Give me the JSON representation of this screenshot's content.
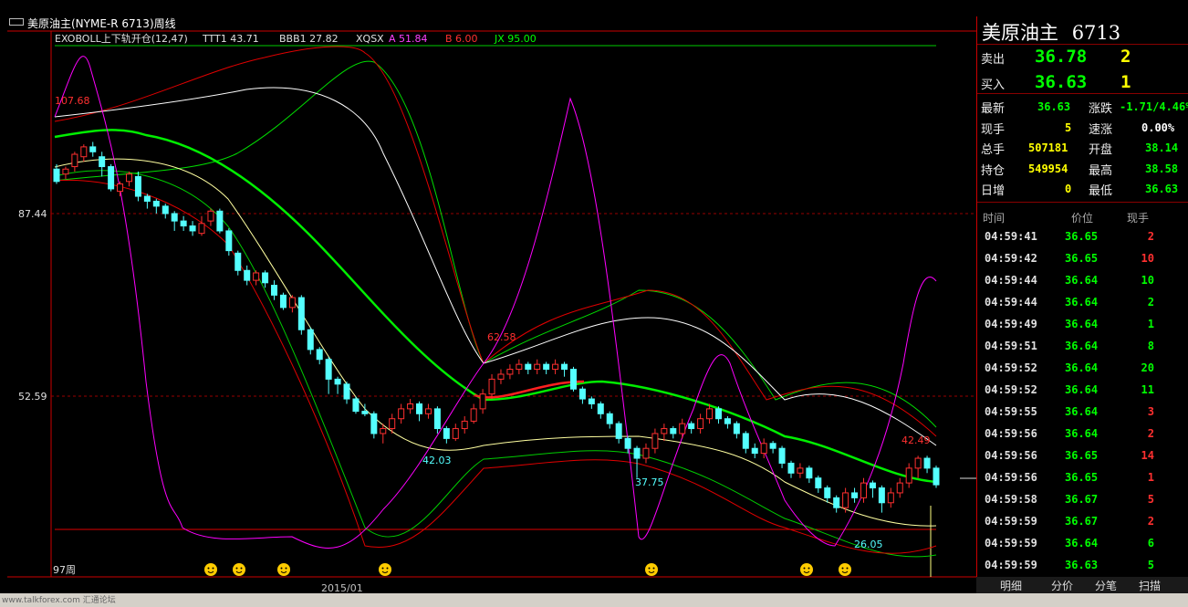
{
  "window": {
    "title": "美原油主(NYME-R 6713)周线"
  },
  "indicator_bar": {
    "name": "EXOBOLL上下轨开仓(12,47)",
    "ttt1": "TTT1 43.71",
    "bbb1": "BBB1 27.82",
    "xqsx": "XQSX",
    "a": "A 51.84",
    "b": "B 6.00",
    "jx": "JX 95.00"
  },
  "axis": {
    "y_labels": [
      "87.44",
      "52.59"
    ],
    "x_label": "2015/01",
    "period_label": "97周"
  },
  "annotations": {
    "high_left": "107.68",
    "low_1": "42.03",
    "high_mid": "62.58",
    "low_2": "37.75",
    "high_right": "42.49",
    "low_3": "26.05"
  },
  "quote": {
    "title": "美原油主",
    "code": "6713",
    "sell_label": "卖出",
    "sell_price": "36.78",
    "sell_vol": "2",
    "buy_label": "买入",
    "buy_price": "36.63",
    "buy_vol": "1",
    "latest_label": "最新",
    "latest": "36.63",
    "change_label": "涨跌",
    "change": "-1.71/4.46%",
    "current_label": "现手",
    "current": "5",
    "speed_label": "速涨",
    "speed": "0.00%",
    "total_label": "总手",
    "total": "507181",
    "open_label": "开盘",
    "open": "38.14",
    "position_label": "持仓",
    "position": "549954",
    "high_label": "最高",
    "high": "38.58",
    "daily_label": "日增",
    "daily": "0",
    "low_label": "最低",
    "low": "36.63"
  },
  "ticks": {
    "headers": [
      "时间",
      "价位",
      "现手"
    ],
    "rows": [
      {
        "time": "04:59:41",
        "price": "36.65",
        "vol": "2",
        "dir": "up"
      },
      {
        "time": "04:59:42",
        "price": "36.65",
        "vol": "10",
        "dir": "up"
      },
      {
        "time": "04:59:44",
        "price": "36.64",
        "vol": "10",
        "dir": "down"
      },
      {
        "time": "04:59:44",
        "price": "36.64",
        "vol": "2",
        "dir": "down"
      },
      {
        "time": "04:59:49",
        "price": "36.64",
        "vol": "1",
        "dir": "down"
      },
      {
        "time": "04:59:51",
        "price": "36.64",
        "vol": "8",
        "dir": "down"
      },
      {
        "time": "04:59:52",
        "price": "36.64",
        "vol": "20",
        "dir": "down"
      },
      {
        "time": "04:59:52",
        "price": "36.64",
        "vol": "11",
        "dir": "down"
      },
      {
        "time": "04:59:55",
        "price": "36.64",
        "vol": "3",
        "dir": "up"
      },
      {
        "time": "04:59:56",
        "price": "36.64",
        "vol": "2",
        "dir": "up"
      },
      {
        "time": "04:59:56",
        "price": "36.65",
        "vol": "14",
        "dir": "up"
      },
      {
        "time": "04:59:56",
        "price": "36.65",
        "vol": "1",
        "dir": "up"
      },
      {
        "time": "04:59:58",
        "price": "36.67",
        "vol": "5",
        "dir": "up"
      },
      {
        "time": "04:59:59",
        "price": "36.67",
        "vol": "2",
        "dir": "up"
      },
      {
        "time": "04:59:59",
        "price": "36.64",
        "vol": "6",
        "dir": "down"
      },
      {
        "time": "04:59:59",
        "price": "36.63",
        "vol": "5",
        "dir": "down"
      }
    ]
  },
  "tabs": [
    "明细",
    "分价",
    "分笔",
    "扫描"
  ],
  "footer": {
    "text": "www.talkforex.com 汇通论坛"
  },
  "colors": {
    "up": "#ff3030",
    "down": "#54ffff",
    "green_text": "#00ff00",
    "yellow": "#ffff00",
    "magenta": "#ff00ff"
  },
  "chart_data": {
    "type": "candlestick",
    "title": "",
    "ylim": [
      18,
      124
    ],
    "candles": [
      [
        100.5,
        98,
        101.5,
        97.5
      ],
      [
        99.5,
        100.5,
        101,
        98.5
      ],
      [
        101,
        103.5,
        104,
        100
      ],
      [
        103,
        105,
        105.5,
        102
      ],
      [
        105,
        104,
        106,
        103
      ],
      [
        103,
        101,
        104,
        99
      ],
      [
        101,
        96.5,
        101.5,
        96
      ],
      [
        96,
        97.5,
        98,
        95
      ],
      [
        98,
        99.5,
        100,
        97
      ],
      [
        99,
        95,
        100,
        94
      ],
      [
        95,
        94,
        95.5,
        92.5
      ],
      [
        94,
        93,
        94.5,
        91.5
      ],
      [
        93,
        91.5,
        93.5,
        90.5
      ],
      [
        91.5,
        90,
        92,
        88
      ],
      [
        90,
        89,
        91,
        88
      ],
      [
        89,
        88,
        90,
        87
      ],
      [
        87.5,
        89.5,
        91,
        87
      ],
      [
        90,
        92,
        92.5,
        89
      ],
      [
        92,
        88,
        92.5,
        87.5
      ],
      [
        88,
        84,
        88.5,
        83
      ],
      [
        83.5,
        80,
        84,
        79
      ],
      [
        80,
        78,
        81,
        77
      ],
      [
        78,
        79.5,
        80,
        77
      ],
      [
        79.5,
        77.5,
        80,
        76.5
      ],
      [
        77,
        75,
        78,
        74
      ],
      [
        75,
        72.5,
        75.5,
        72
      ],
      [
        72.5,
        74.5,
        75,
        71.5
      ],
      [
        74.5,
        68,
        75,
        67
      ],
      [
        68,
        64,
        68.5,
        63
      ],
      [
        64,
        62,
        64.5,
        61
      ],
      [
        62,
        58,
        62.5,
        55
      ],
      [
        58,
        57,
        58.5,
        55
      ],
      [
        57,
        54,
        57.5,
        53
      ],
      [
        54,
        51.5,
        54.5,
        51
      ],
      [
        51.5,
        51,
        53,
        50.5
      ],
      [
        51,
        47,
        51.5,
        46
      ],
      [
        47,
        48,
        49,
        45
      ],
      [
        48,
        50,
        51,
        47
      ],
      [
        50,
        52,
        53,
        49
      ],
      [
        52,
        53,
        54,
        51
      ],
      [
        53,
        51,
        53.5,
        49.5
      ],
      [
        51,
        52,
        53,
        50
      ],
      [
        52,
        48,
        52.5,
        47
      ],
      [
        48,
        46,
        48.5,
        45
      ],
      [
        46,
        48,
        49,
        45.5
      ],
      [
        48,
        49.5,
        50.5,
        47
      ],
      [
        49.5,
        52,
        53,
        49
      ],
      [
        52,
        55,
        56,
        51
      ],
      [
        55,
        58,
        59,
        54
      ],
      [
        58,
        59,
        60,
        57
      ],
      [
        59,
        60,
        61,
        58
      ],
      [
        60,
        61,
        62,
        59
      ],
      [
        61,
        60,
        61.5,
        59
      ],
      [
        60,
        61,
        62,
        59
      ],
      [
        61,
        60,
        61.5,
        59
      ],
      [
        60,
        61,
        62,
        59
      ],
      [
        61,
        60,
        61.5,
        58.5
      ],
      [
        60,
        56,
        60.5,
        55.5
      ],
      [
        56,
        54,
        56.5,
        53
      ],
      [
        54,
        53,
        54.5,
        52
      ],
      [
        53,
        51,
        53.5,
        50
      ],
      [
        51,
        49,
        51.5,
        48
      ],
      [
        49,
        46,
        49.5,
        45
      ],
      [
        46,
        44,
        46.5,
        43
      ],
      [
        44,
        42,
        44.5,
        38
      ],
      [
        42,
        44,
        45,
        41
      ],
      [
        44,
        47,
        48,
        43
      ],
      [
        47,
        48,
        49,
        45.5
      ],
      [
        48,
        47,
        48.5,
        46
      ],
      [
        47,
        49,
        50,
        46
      ],
      [
        49,
        48,
        49.5,
        47
      ],
      [
        48,
        50,
        51,
        47
      ],
      [
        50,
        52,
        53,
        49
      ],
      [
        52,
        50,
        52.5,
        49
      ],
      [
        50,
        49,
        50.5,
        48
      ],
      [
        49,
        47,
        49.5,
        46
      ],
      [
        47,
        44,
        47.5,
        43
      ],
      [
        44,
        43,
        45,
        42
      ],
      [
        43,
        45,
        46,
        42
      ],
      [
        45,
        44,
        45.5,
        43
      ],
      [
        44,
        41,
        44.5,
        40
      ],
      [
        41,
        39,
        41.5,
        38
      ],
      [
        39,
        40,
        41,
        38
      ],
      [
        40,
        38,
        40.5,
        37
      ],
      [
        38,
        36,
        38.5,
        35
      ],
      [
        36,
        34,
        36.5,
        33
      ],
      [
        34,
        32,
        34.5,
        31
      ],
      [
        32,
        35,
        36,
        31
      ],
      [
        35,
        34,
        36,
        33
      ],
      [
        34,
        37,
        38,
        33
      ],
      [
        37,
        36,
        37.5,
        34
      ],
      [
        36,
        33,
        36.5,
        31
      ],
      [
        33,
        35,
        36,
        32
      ],
      [
        35,
        37,
        38,
        34
      ],
      [
        37,
        40,
        41,
        36
      ],
      [
        40,
        42,
        42.49,
        38
      ],
      [
        42,
        40,
        42.5,
        39
      ],
      [
        40,
        36.63,
        40.5,
        36
      ]
    ]
  }
}
